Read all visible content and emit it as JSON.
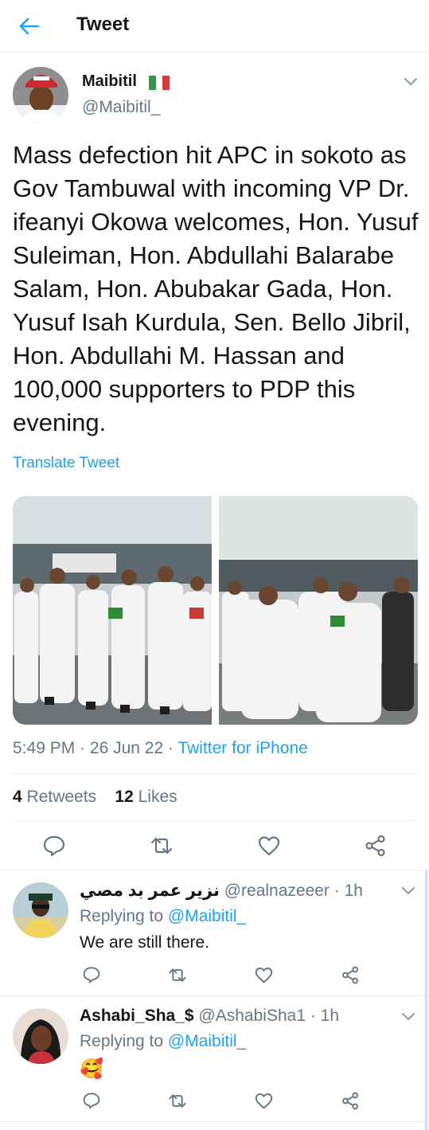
{
  "header": {
    "title": "Tweet",
    "back_icon": "arrow-left-icon"
  },
  "tweet": {
    "author_name": "Maibitil",
    "author_flag": "Italy flag emoji",
    "author_handle": "@Maibitil_",
    "text": "Mass defection hit APC in sokoto as Gov Tambuwal with incoming VP Dr. ifeanyi Okowa welcomes, Hon. Yusuf Suleiman, Hon. Abdullahi Balarabe Salam, Hon. Abubakar Gada, Hon. Yusuf Isah Kurdula, Sen. Bello Jibril, Hon. Abdullahi M. Hassan and 100,000 supporters to PDP this evening.",
    "translate_label": "Translate Tweet",
    "time": "5:49 PM",
    "date": "26 Jun 22",
    "source": "Twitter for iPhone",
    "retweets_count": "4",
    "retweets_label": "Retweets",
    "likes_count": "12",
    "likes_label": "Likes"
  },
  "replies": [
    {
      "name": "نزير عمر بد مصي",
      "handle": "@realnazeeer",
      "time": "1h",
      "replying_prefix": "Replying to",
      "replying_to": "@Maibitil_",
      "text": "We are still there."
    },
    {
      "name": "Ashabi_Sha_$",
      "handle": "@AshabiSha1",
      "time": "1h",
      "replying_prefix": "Replying to",
      "replying_to": "@Maibitil_",
      "text": "🥰"
    }
  ],
  "colors": {
    "accent": "#1da1f2",
    "secondary_text": "#657786",
    "divider": "#e6ecf0"
  }
}
